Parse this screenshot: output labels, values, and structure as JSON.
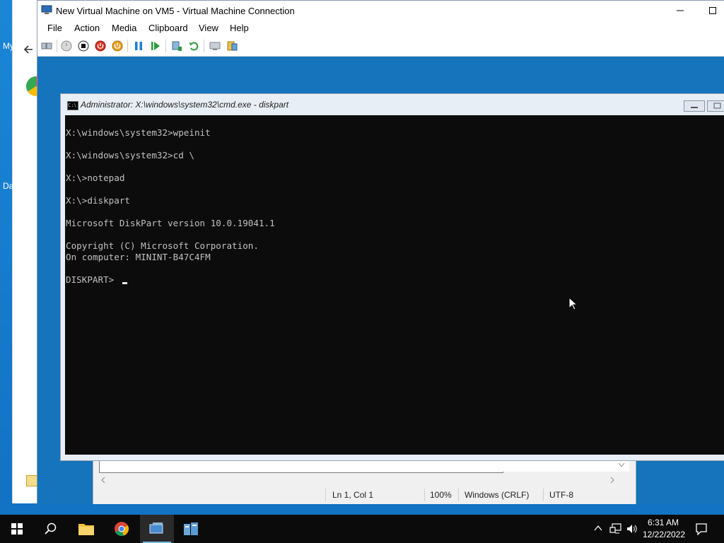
{
  "vm_window": {
    "title": "New Virtual Machine on VM5 - Virtual Machine Connection",
    "menu": [
      "File",
      "Action",
      "Media",
      "Clipboard",
      "View",
      "Help"
    ]
  },
  "toolbar": {
    "buttons": [
      "ctrl-alt-del",
      "start",
      "turn-off",
      "shut-down",
      "save",
      "pause",
      "resume",
      "checkpoint",
      "revert",
      "enhanced-session",
      "share"
    ]
  },
  "cmd": {
    "title": "Administrator: X:\\windows\\system32\\cmd.exe - diskpart",
    "lines": [
      "X:\\windows\\system32>wpeinit",
      "",
      "X:\\windows\\system32>cd \\",
      "",
      "X:\\>notepad",
      "",
      "X:\\>diskpart",
      "",
      "Microsoft DiskPart version 10.0.19041.1",
      "",
      "Copyright (C) Microsoft Corporation.",
      "On computer: MININT-B47C4FM",
      "",
      "DISKPART> "
    ]
  },
  "notepad": {
    "position": "Ln 1, Col 1",
    "zoom": "100%",
    "line_ending": "Windows (CRLF)",
    "encoding": "UTF-8"
  },
  "host": {
    "fragment_my": "My",
    "fragment_da": "Da"
  },
  "taskbar": {
    "time": "6:31 AM",
    "date": "12/22/2022"
  }
}
